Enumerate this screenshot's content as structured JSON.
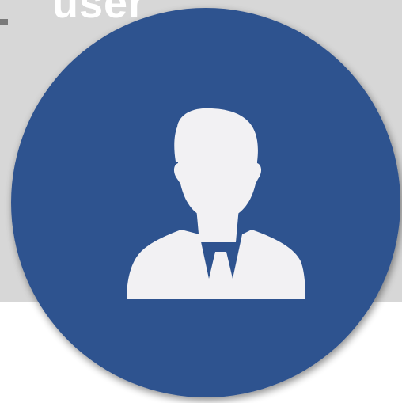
{
  "caption": {
    "text": "user"
  },
  "avatar": {
    "icon": "user-businessman-icon",
    "circle_color": "#2f528f",
    "figure_color": "#f2f1f3",
    "background_color": "#d7d7d7"
  }
}
